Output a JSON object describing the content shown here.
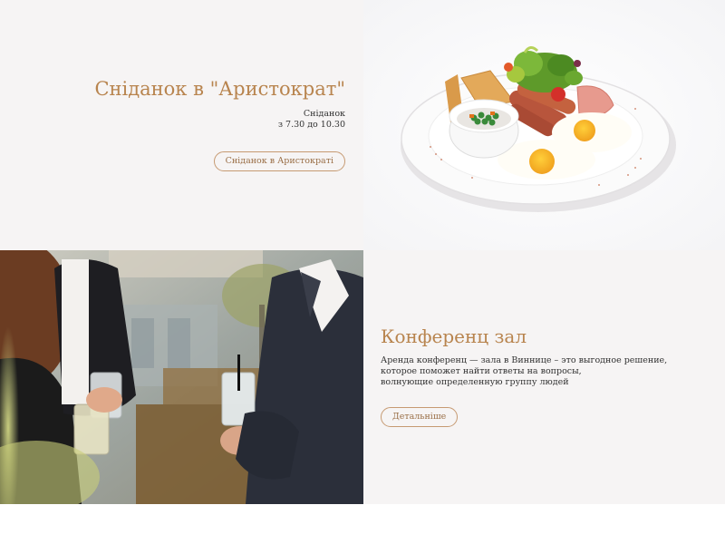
{
  "breakfast": {
    "title": "Сніданок в \"Аристократ\"",
    "subtitle_line1": "Сніданок",
    "subtitle_line2": "з 7.30 до 10.30",
    "button_label": "Сніданок в Аристократі"
  },
  "conference": {
    "title": "Конференц зал",
    "description_line1": "Аренда конференц — зала в Виннице – это выгодное решение,",
    "description_line2": "которое поможет найти ответы на вопросы,",
    "description_line3": "волнующие определенную группу людей",
    "button_label": "Детальніше"
  },
  "colors": {
    "accent": "#b8844e",
    "panel_bg": "#f6f4f4",
    "button_border": "#c69a72",
    "body_text": "#333333"
  }
}
